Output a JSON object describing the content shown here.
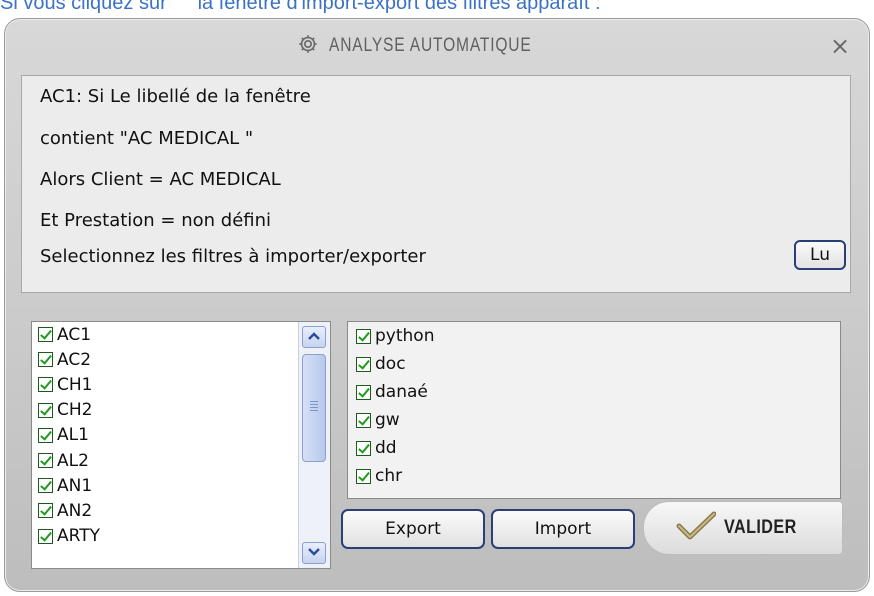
{
  "doc_line": "Si vous cliquez sur \" \" la fenêtre d'import-export des filtres apparaît :",
  "window": {
    "title": "ANALYSE AUTOMATIQUE",
    "title_icon": "gear-icon",
    "close_label": "×"
  },
  "info": {
    "lines": [
      "AC1: Si Le libellé de la fenêtre",
      "contient \"AC MEDICAL \"",
      "Alors Client = AC MEDICAL",
      "Et Prestation = non défini",
      "Selectionnez les filtres à importer/exporter"
    ],
    "lu_button": "Lu"
  },
  "left_list": {
    "items": [
      "AC1",
      "AC2",
      "CH1",
      "CH2",
      "AL1",
      "AL2",
      "AN1",
      "AN2",
      "ARTY"
    ],
    "checked": [
      true,
      true,
      true,
      true,
      true,
      true,
      true,
      true,
      true
    ]
  },
  "right_list": {
    "items": [
      "python",
      "doc",
      "danaé",
      "gw",
      "dd",
      "chr"
    ],
    "checked": [
      true,
      true,
      true,
      true,
      true,
      true
    ]
  },
  "buttons": {
    "export": "Export",
    "import": "Import",
    "valider": "VALIDER"
  },
  "colors": {
    "doc_text": "#3a72c8",
    "check": "#1e9a1e",
    "button_border": "#2a3f7a",
    "valider_check": "#8a7a4a"
  }
}
